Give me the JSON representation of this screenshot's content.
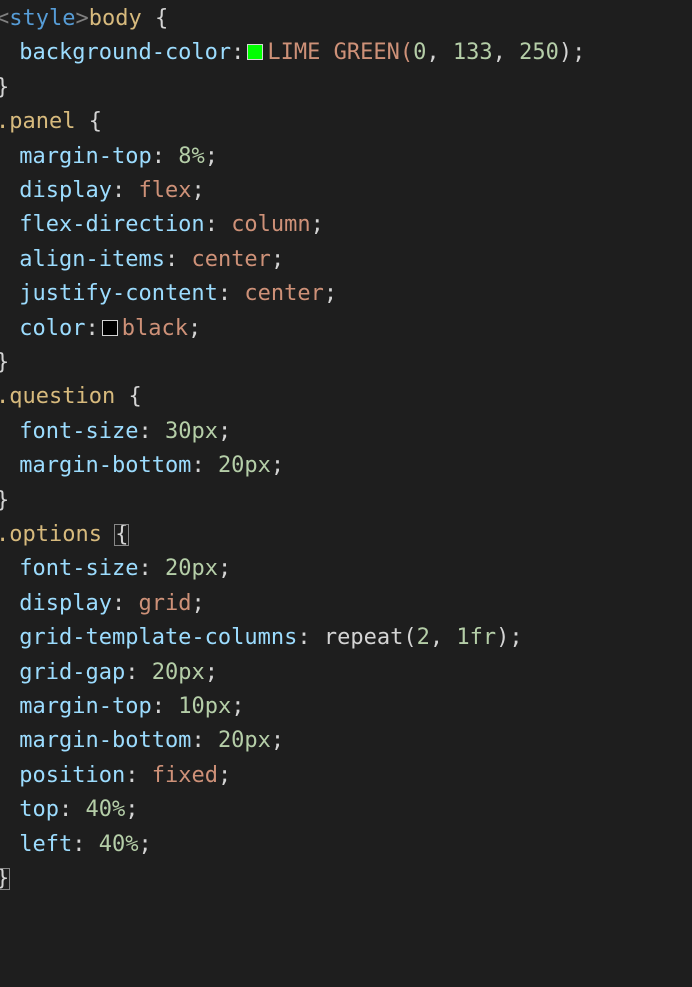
{
  "colors": {
    "background": "#1e1e1e",
    "default": "#d4d4d4",
    "tag": "#808080",
    "tag_name": "#569cd6",
    "selector": "#d7ba7d",
    "property": "#9cdcfe",
    "value": "#ce9178",
    "number": "#b5cea8",
    "swatch_green": "#00ff00",
    "swatch_black": "#000000"
  },
  "lines": [
    {
      "tokens": [
        {
          "t": "<",
          "c": "tag"
        },
        {
          "t": "style",
          "c": "tag_name"
        },
        {
          "t": ">",
          "c": "tag"
        },
        {
          "t": "body",
          "c": "selector"
        },
        {
          "t": " {",
          "c": "default"
        }
      ]
    },
    {
      "tokens": [
        {
          "t": " background-color",
          "c": "property"
        },
        {
          "t": ":",
          "c": "default"
        },
        {
          "swatch": "swatch_green"
        },
        {
          "t": "LIME GREEN(",
          "c": "value"
        },
        {
          "t": "0",
          "c": "number"
        },
        {
          "t": ", ",
          "c": "default"
        },
        {
          "t": "133",
          "c": "number"
        },
        {
          "t": ", ",
          "c": "default"
        },
        {
          "t": "250",
          "c": "number"
        },
        {
          "t": ");",
          "c": "default"
        }
      ]
    },
    {
      "tokens": [
        {
          "t": "}",
          "c": "default"
        }
      ]
    },
    {
      "tokens": [
        {
          "t": ".panel",
          "c": "selector"
        },
        {
          "t": " {",
          "c": "default"
        }
      ]
    },
    {
      "tokens": [
        {
          "t": " margin-top",
          "c": "property"
        },
        {
          "t": ": ",
          "c": "default"
        },
        {
          "t": "8%",
          "c": "number"
        },
        {
          "t": ";",
          "c": "default"
        }
      ]
    },
    {
      "tokens": [
        {
          "t": " display",
          "c": "property"
        },
        {
          "t": ": ",
          "c": "default"
        },
        {
          "t": "flex",
          "c": "value"
        },
        {
          "t": ";",
          "c": "default"
        }
      ]
    },
    {
      "tokens": [
        {
          "t": " flex-direction",
          "c": "property"
        },
        {
          "t": ": ",
          "c": "default"
        },
        {
          "t": "column",
          "c": "value"
        },
        {
          "t": ";",
          "c": "default"
        }
      ]
    },
    {
      "tokens": [
        {
          "t": " align-items",
          "c": "property"
        },
        {
          "t": ": ",
          "c": "default"
        },
        {
          "t": "center",
          "c": "value"
        },
        {
          "t": ";",
          "c": "default"
        }
      ]
    },
    {
      "tokens": [
        {
          "t": " justify-content",
          "c": "property"
        },
        {
          "t": ": ",
          "c": "default"
        },
        {
          "t": "center",
          "c": "value"
        },
        {
          "t": ";",
          "c": "default"
        }
      ]
    },
    {
      "tokens": [
        {
          "t": " color",
          "c": "property"
        },
        {
          "t": ":",
          "c": "default"
        },
        {
          "swatch": "swatch_black"
        },
        {
          "t": "black",
          "c": "value"
        },
        {
          "t": ";",
          "c": "default"
        }
      ]
    },
    {
      "tokens": [
        {
          "t": "}",
          "c": "default"
        }
      ]
    },
    {
      "tokens": [
        {
          "t": ".question",
          "c": "selector"
        },
        {
          "t": " {",
          "c": "default"
        }
      ]
    },
    {
      "tokens": [
        {
          "t": " font-size",
          "c": "property"
        },
        {
          "t": ": ",
          "c": "default"
        },
        {
          "t": "30px",
          "c": "number"
        },
        {
          "t": ";",
          "c": "default"
        }
      ]
    },
    {
      "tokens": [
        {
          "t": " margin-bottom",
          "c": "property"
        },
        {
          "t": ": ",
          "c": "default"
        },
        {
          "t": "20px",
          "c": "number"
        },
        {
          "t": ";",
          "c": "default"
        }
      ]
    },
    {
      "tokens": [
        {
          "t": "}",
          "c": "default"
        }
      ]
    },
    {
      "tokens": [
        {
          "t": ".options",
          "c": "selector"
        },
        {
          "t": " ",
          "c": "default"
        },
        {
          "t": "{",
          "c": "default",
          "box": "bracket"
        }
      ]
    },
    {
      "tokens": [
        {
          "t": " font-size",
          "c": "property"
        },
        {
          "t": ": ",
          "c": "default"
        },
        {
          "t": "20px",
          "c": "number"
        },
        {
          "t": ";",
          "c": "default"
        }
      ]
    },
    {
      "tokens": [
        {
          "t": " display",
          "c": "property"
        },
        {
          "t": ": ",
          "c": "default"
        },
        {
          "t": "grid",
          "c": "value"
        },
        {
          "t": ";",
          "c": "default"
        }
      ]
    },
    {
      "tokens": [
        {
          "t": " grid-template-columns",
          "c": "property"
        },
        {
          "t": ": repeat(",
          "c": "default"
        },
        {
          "t": "2",
          "c": "number"
        },
        {
          "t": ", ",
          "c": "default"
        },
        {
          "t": "1fr",
          "c": "number"
        },
        {
          "t": ");",
          "c": "default"
        }
      ]
    },
    {
      "tokens": [
        {
          "t": " grid-gap",
          "c": "property"
        },
        {
          "t": ": ",
          "c": "default"
        },
        {
          "t": "20px",
          "c": "number"
        },
        {
          "t": ";",
          "c": "default"
        }
      ]
    },
    {
      "tokens": [
        {
          "t": " margin-top",
          "c": "property"
        },
        {
          "t": ": ",
          "c": "default"
        },
        {
          "t": "10px",
          "c": "number"
        },
        {
          "t": ";",
          "c": "default"
        }
      ]
    },
    {
      "tokens": [
        {
          "t": " margin-bottom",
          "c": "property"
        },
        {
          "t": ": ",
          "c": "default"
        },
        {
          "t": "20px",
          "c": "number"
        },
        {
          "t": ";",
          "c": "default"
        }
      ]
    },
    {
      "tokens": [
        {
          "t": " position",
          "c": "property"
        },
        {
          "t": ": ",
          "c": "default"
        },
        {
          "t": "fixed",
          "c": "value"
        },
        {
          "t": ";",
          "c": "default"
        }
      ]
    },
    {
      "tokens": [
        {
          "t": " top",
          "c": "property"
        },
        {
          "t": ": ",
          "c": "default"
        },
        {
          "t": "40%",
          "c": "number"
        },
        {
          "t": ";",
          "c": "default"
        }
      ]
    },
    {
      "tokens": [
        {
          "t": " left",
          "c": "property"
        },
        {
          "t": ": ",
          "c": "default"
        },
        {
          "t": "40%",
          "c": "number"
        },
        {
          "t": ";",
          "c": "default"
        }
      ]
    },
    {
      "tokens": [
        {
          "t": "}",
          "c": "default",
          "box": "cursor"
        }
      ]
    }
  ]
}
